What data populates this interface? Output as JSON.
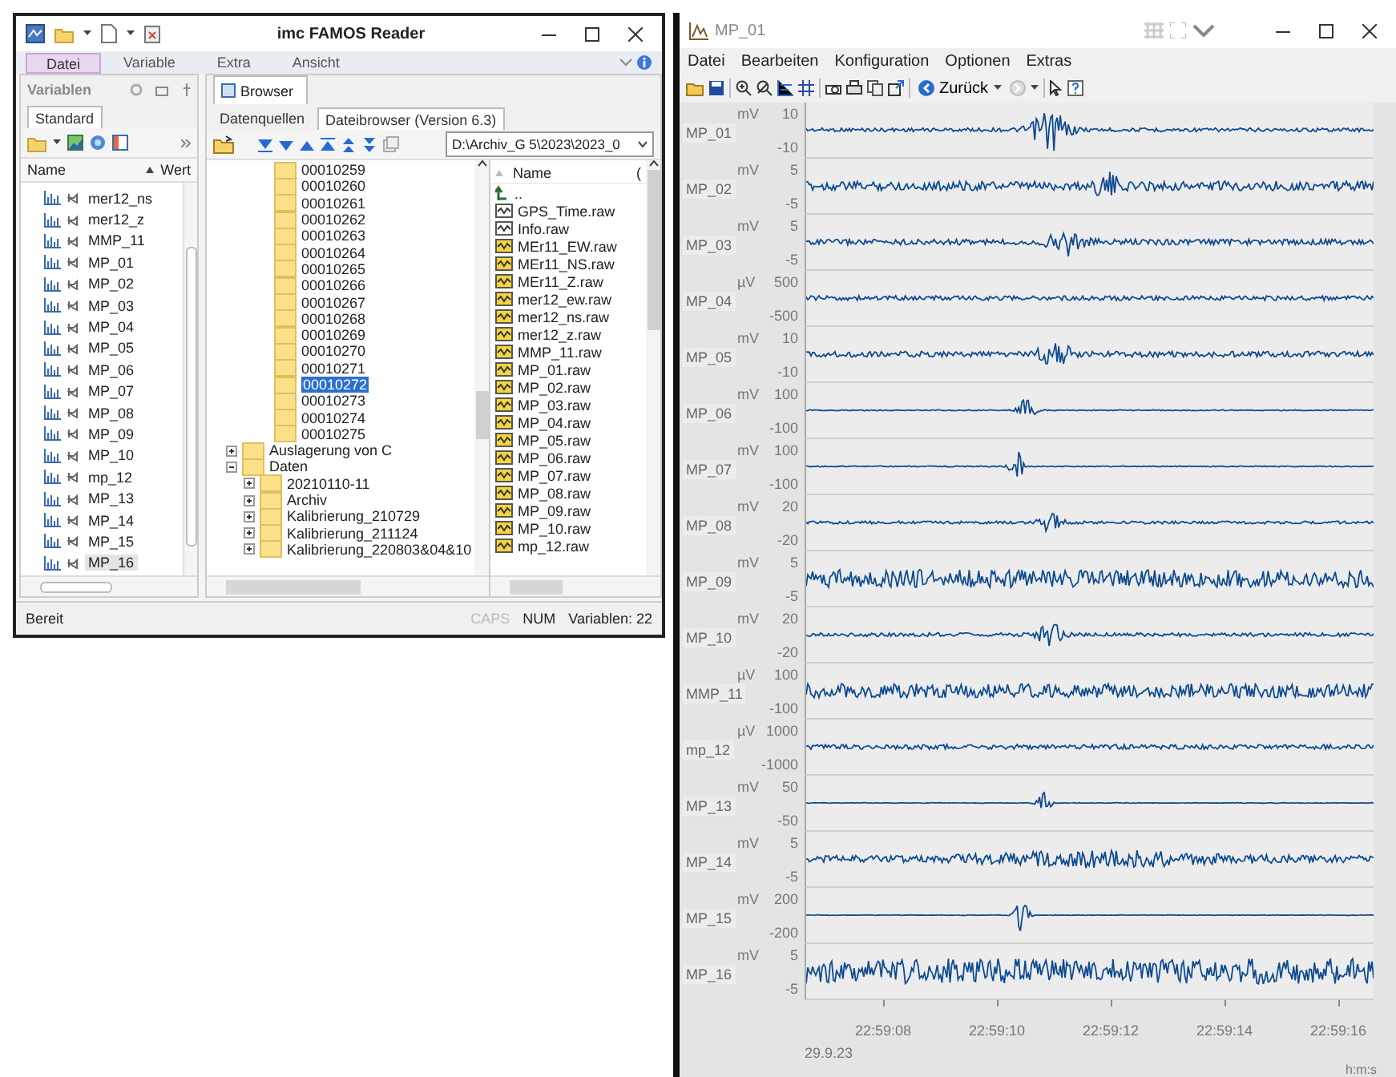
{
  "famos_window": {
    "title": "imc FAMOS Reader",
    "ribbon_tabs": [
      {
        "label": "Datei",
        "selected": true
      },
      {
        "label": "Variable",
        "selected": false
      },
      {
        "label": "Extra",
        "selected": false
      },
      {
        "label": "Ansicht",
        "selected": false
      }
    ],
    "variables_panel": {
      "title": "Variablen",
      "tabs": [
        {
          "label": "Standard",
          "selected": true
        }
      ],
      "columns": [
        "Name",
        "Wert"
      ],
      "items": [
        {
          "name": "mer12_ns",
          "selected": false
        },
        {
          "name": "mer12_z",
          "selected": false
        },
        {
          "name": "MMP_11",
          "selected": false
        },
        {
          "name": "MP_01",
          "selected": false
        },
        {
          "name": "MP_02",
          "selected": false
        },
        {
          "name": "MP_03",
          "selected": false
        },
        {
          "name": "MP_04",
          "selected": false
        },
        {
          "name": "MP_05",
          "selected": false
        },
        {
          "name": "MP_06",
          "selected": false
        },
        {
          "name": "MP_07",
          "selected": false
        },
        {
          "name": "MP_08",
          "selected": false
        },
        {
          "name": "MP_09",
          "selected": false
        },
        {
          "name": "MP_10",
          "selected": false
        },
        {
          "name": "mp_12",
          "selected": false
        },
        {
          "name": "MP_13",
          "selected": false
        },
        {
          "name": "MP_14",
          "selected": false
        },
        {
          "name": "MP_15",
          "selected": false
        },
        {
          "name": "MP_16",
          "selected": true
        }
      ]
    },
    "browser_panel": {
      "tab": "Browser",
      "subtabs": [
        {
          "label": "Datenquellen",
          "selected": false
        },
        {
          "label": "Dateibrowser (Version 6.3)",
          "selected": true
        }
      ],
      "path": "D:\\Archiv_G 5\\2023\\2023_0",
      "tree": {
        "scrolled_children": [
          {
            "label": "00010259",
            "selected": false
          },
          {
            "label": "00010260",
            "selected": false
          },
          {
            "label": "00010261",
            "selected": false
          },
          {
            "label": "00010262",
            "selected": false
          },
          {
            "label": "00010263",
            "selected": false
          },
          {
            "label": "00010264",
            "selected": false
          },
          {
            "label": "00010265",
            "selected": false
          },
          {
            "label": "00010266",
            "selected": false
          },
          {
            "label": "00010267",
            "selected": false
          },
          {
            "label": "00010268",
            "selected": false
          },
          {
            "label": "00010269",
            "selected": false
          },
          {
            "label": "00010270",
            "selected": false
          },
          {
            "label": "00010271",
            "selected": false
          },
          {
            "label": "00010272",
            "selected": true
          },
          {
            "label": "00010273",
            "selected": false
          },
          {
            "label": "00010274",
            "selected": false
          },
          {
            "label": "00010275",
            "selected": false
          }
        ],
        "items": [
          {
            "label": "Auslagerung von C",
            "expanded": false
          },
          {
            "label": "Daten",
            "expanded": true,
            "children": [
              {
                "label": "20210110-11",
                "expanded": false
              },
              {
                "label": "Archiv",
                "expanded": false
              },
              {
                "label": "Kalibrierung_210729",
                "expanded": false
              },
              {
                "label": "Kalibrierung_211124",
                "expanded": false
              },
              {
                "label": "Kalibrierung_220803&04&10",
                "expanded": false
              }
            ]
          }
        ]
      },
      "files": {
        "columns": [
          "Name",
          "("
        ],
        "items": [
          {
            "name": "..",
            "kind": "up"
          },
          {
            "name": "GPS_Time.raw",
            "kind": "plain"
          },
          {
            "name": "Info.raw",
            "kind": "plain"
          },
          {
            "name": "MEr11_EW.raw",
            "kind": "signal"
          },
          {
            "name": "MEr11_NS.raw",
            "kind": "signal"
          },
          {
            "name": "MEr11_Z.raw",
            "kind": "signal"
          },
          {
            "name": "mer12_ew.raw",
            "kind": "signal"
          },
          {
            "name": "mer12_ns.raw",
            "kind": "signal"
          },
          {
            "name": "mer12_z.raw",
            "kind": "signal"
          },
          {
            "name": "MMP_11.raw",
            "kind": "signal"
          },
          {
            "name": "MP_01.raw",
            "kind": "signal"
          },
          {
            "name": "MP_02.raw",
            "kind": "signal"
          },
          {
            "name": "MP_03.raw",
            "kind": "signal"
          },
          {
            "name": "MP_04.raw",
            "kind": "signal"
          },
          {
            "name": "MP_05.raw",
            "kind": "signal"
          },
          {
            "name": "MP_06.raw",
            "kind": "signal"
          },
          {
            "name": "MP_07.raw",
            "kind": "signal"
          },
          {
            "name": "MP_08.raw",
            "kind": "signal"
          },
          {
            "name": "MP_09.raw",
            "kind": "signal"
          },
          {
            "name": "MP_10.raw",
            "kind": "signal"
          },
          {
            "name": "mp_12.raw",
            "kind": "signal"
          }
        ]
      }
    },
    "status_bar": {
      "text": "Bereit",
      "indicators": [
        {
          "label": "CAPS",
          "on": false
        },
        {
          "label": "NUM",
          "on": true
        }
      ],
      "count": "Variablen: 22"
    }
  },
  "plot_window": {
    "title": "MP_01",
    "menu": [
      "Datei",
      "Bearbeiten",
      "Konfiguration",
      "Optionen",
      "Extras"
    ],
    "back_button": "Zurück",
    "channels": [
      {
        "name": "MP_01",
        "unit": "mV",
        "max": "10",
        "min": "-10"
      },
      {
        "name": "MP_02",
        "unit": "mV",
        "max": "5",
        "min": "-5"
      },
      {
        "name": "MP_03",
        "unit": "mV",
        "max": "5",
        "min": "-5"
      },
      {
        "name": "MP_04",
        "unit": "µV",
        "max": "500",
        "min": "-500"
      },
      {
        "name": "MP_05",
        "unit": "mV",
        "max": "10",
        "min": "-10"
      },
      {
        "name": "MP_06",
        "unit": "mV",
        "max": "100",
        "min": "-100"
      },
      {
        "name": "MP_07",
        "unit": "mV",
        "max": "100",
        "min": "-100"
      },
      {
        "name": "MP_08",
        "unit": "mV",
        "max": "20",
        "min": "-20"
      },
      {
        "name": "MP_09",
        "unit": "mV",
        "max": "5",
        "min": "-5"
      },
      {
        "name": "MP_10",
        "unit": "mV",
        "max": "20",
        "min": "-20"
      },
      {
        "name": "MMP_11",
        "unit": "µV",
        "max": "100",
        "min": "-100"
      },
      {
        "name": "mp_12",
        "unit": "µV",
        "max": "1000",
        "min": "-1000"
      },
      {
        "name": "MP_13",
        "unit": "mV",
        "max": "50",
        "min": "-50"
      },
      {
        "name": "MP_14",
        "unit": "mV",
        "max": "5",
        "min": "-5"
      },
      {
        "name": "MP_15",
        "unit": "mV",
        "max": "200",
        "min": "-200"
      },
      {
        "name": "MP_16",
        "unit": "mV",
        "max": "5",
        "min": "-5"
      }
    ],
    "time_axis": {
      "ticks": [
        "22:59:08",
        "22:59:10",
        "22:59:12",
        "22:59:14",
        "22:59:16"
      ],
      "date": "29.9.23",
      "unit": "h:m:s"
    }
  }
}
